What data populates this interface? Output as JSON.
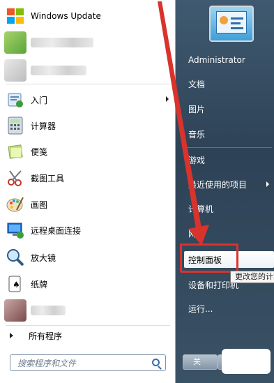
{
  "left_programs": [
    {
      "label": "Windows Update",
      "icon": "windows-update-icon",
      "has_arrow": false,
      "blurred": false
    },
    {
      "label": "",
      "icon": "blurred-app-icon",
      "has_arrow": true,
      "blurred": true
    },
    {
      "label": "",
      "icon": "blurred-app-icon",
      "has_arrow": false,
      "blurred": true
    },
    {
      "label": "入门",
      "icon": "getting-started-icon",
      "has_arrow": true,
      "blurred": false
    },
    {
      "label": "计算器",
      "icon": "calculator-icon",
      "has_arrow": false,
      "blurred": false
    },
    {
      "label": "便笺",
      "icon": "sticky-notes-icon",
      "has_arrow": false,
      "blurred": false
    },
    {
      "label": "截图工具",
      "icon": "snipping-tool-icon",
      "has_arrow": false,
      "blurred": false
    },
    {
      "label": "画图",
      "icon": "paint-icon",
      "has_arrow": false,
      "blurred": false
    },
    {
      "label": "远程桌面连接",
      "icon": "remote-desktop-icon",
      "has_arrow": false,
      "blurred": false
    },
    {
      "label": "放大镜",
      "icon": "magnifier-icon",
      "has_arrow": false,
      "blurred": false
    },
    {
      "label": "纸牌",
      "icon": "solitaire-icon",
      "has_arrow": false,
      "blurred": false
    },
    {
      "label": "",
      "icon": "blurred-app-icon",
      "has_arrow": false,
      "blurred": true
    }
  ],
  "all_programs_label": "所有程序",
  "search": {
    "placeholder": "搜索程序和文件"
  },
  "right_items": [
    {
      "label": "Administrator",
      "has_arrow": false
    },
    {
      "label": "文档",
      "has_arrow": false
    },
    {
      "label": "图片",
      "has_arrow": false
    },
    {
      "label": "音乐",
      "has_arrow": false
    },
    {
      "label": "游戏",
      "has_arrow": false
    },
    {
      "label": "最近使用的项目",
      "has_arrow": true
    },
    {
      "label": "计算机",
      "has_arrow": false
    },
    {
      "label": "网络",
      "has_arrow": false
    },
    {
      "label": "控制面板",
      "has_arrow": false,
      "highlighted": true
    },
    {
      "label": "设备和打印机",
      "has_arrow": false
    },
    {
      "label": "运行...",
      "has_arrow": false
    }
  ],
  "tooltip": "更改您的计算",
  "shutdown_label": "关",
  "colors": {
    "highlight_box": "#d8332c",
    "arrow": "#d8332c",
    "panel_bg": "#2e4256"
  }
}
